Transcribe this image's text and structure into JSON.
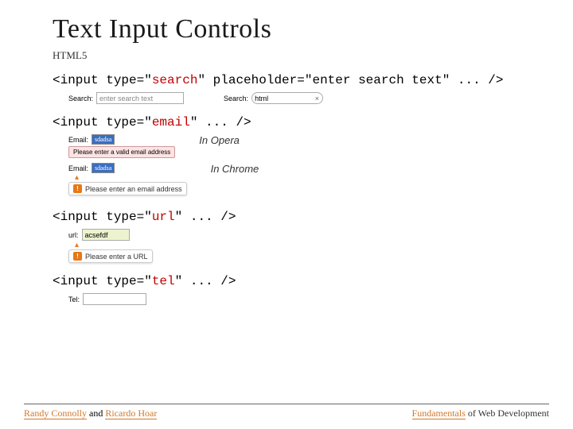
{
  "title": "Text Input Controls",
  "subtitle": "HTML5",
  "code": {
    "search": {
      "p1": "<input type=\"",
      "t": "search",
      "p2": "\" placeholder=\"enter search text\" ... />"
    },
    "email": {
      "p1": "<input type=\"",
      "t": "email",
      "p2": "\" ... />"
    },
    "url": {
      "p1": "<input type=\"",
      "t": "url",
      "p2": "\" ... />"
    },
    "tel": {
      "p1": "<input type=\"",
      "t": "tel",
      "p2": "\" ... />"
    }
  },
  "examples": {
    "search": {
      "label1": "Search:",
      "placeholder1": "enter search text",
      "label2": "Search:",
      "value2": "html",
      "clear": "×"
    },
    "email": {
      "label1": "Email:",
      "value1": "sdadsa",
      "opera_err": "Please enter a valid email address",
      "opera_note": "In Opera",
      "label2": "Email:",
      "value2": "sdadsa",
      "chrome_err": "Please enter an email address",
      "chrome_note": "In Chrome"
    },
    "url": {
      "label": "url:",
      "value": "acsefdf",
      "chrome_err": "Please enter a URL"
    },
    "tel": {
      "label": "Tel:"
    }
  },
  "footer": {
    "author1": "Randy Connolly",
    "and": " and ",
    "author2": "Ricardo Hoar",
    "right1": "Fundamentals",
    "right2": " of Web Development"
  }
}
